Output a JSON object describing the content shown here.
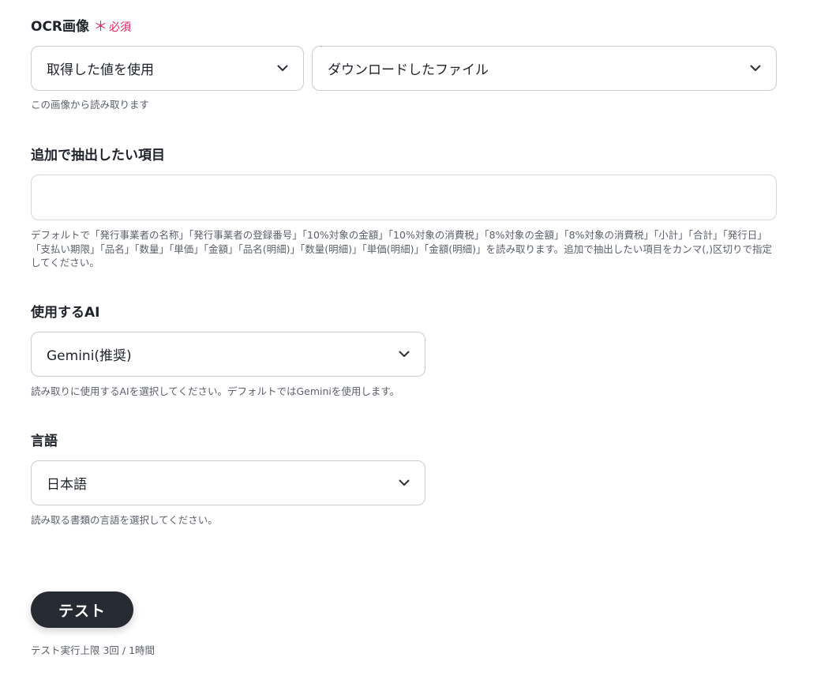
{
  "ocr_image": {
    "label": "OCR画像",
    "required_star": "＊",
    "required_text": "必須",
    "source_select_value": "取得した値を使用",
    "file_select_value": "ダウンロードしたファイル",
    "help": "この画像から読み取ります"
  },
  "extra_fields": {
    "label": "追加で抽出したい項目",
    "value": "",
    "placeholder": "",
    "help": "デフォルトで「発行事業者の名称」「発行事業者の登録番号」「10%対象の金額」「10%対象の消費税」「8%対象の金額」「8%対象の消費税」「小計」「合計」「発行日」「支払い期限」「品名」「数量」「単価」「金額」「品名(明細)」「数量(明細)」「単価(明細)」「金額(明細)」を読み取ります。追加で抽出したい項目をカンマ(,)区切りで指定してください。"
  },
  "ai_model": {
    "label": "使用するAI",
    "select_value": "Gemini(推奨)",
    "help": "読み取りに使用するAIを選択してください。デフォルトではGeminiを使用します。"
  },
  "language": {
    "label": "言語",
    "select_value": "日本語",
    "help": "読み取る書類の言語を選択してください。"
  },
  "test": {
    "button_label": "テスト",
    "limit_text": "テスト実行上限 3回 / 1時間"
  },
  "icons": {
    "chevron": "chevron-down-icon"
  },
  "colors": {
    "required": "#e0245e",
    "button_bg": "#262b33",
    "border": "#c9ccd1",
    "help_text": "#5b6069"
  }
}
